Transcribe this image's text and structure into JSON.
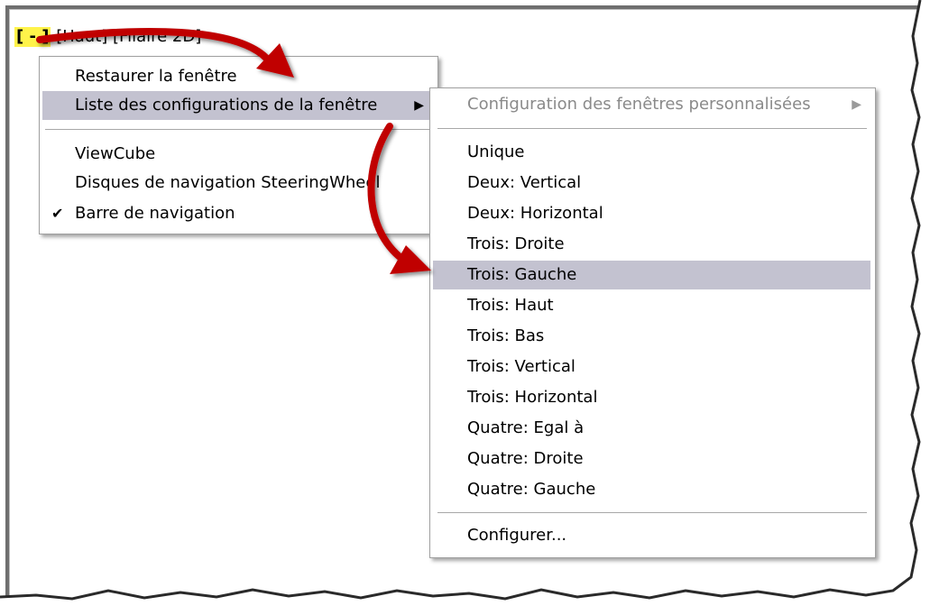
{
  "viewport": {
    "label_minus": "[ - ]",
    "label_view": "[Haut]",
    "label_style": "[Filaire 2D]"
  },
  "main_menu": {
    "items": [
      {
        "label": "Restaurer la fenêtre"
      },
      {
        "label": "Liste des configurations de la fenêtre",
        "submenu_arrow": "▶",
        "highlighted": true
      },
      {
        "label": "ViewCube"
      },
      {
        "label": "Disques de navigation SteeringWheel"
      },
      {
        "label": "Barre de navigation",
        "checked": true,
        "check_mark": "✔"
      }
    ]
  },
  "sub_menu": {
    "header": {
      "label": "Configuration des fenêtres personnalisées",
      "submenu_arrow": "▶",
      "disabled": true
    },
    "items": [
      {
        "label": "Unique"
      },
      {
        "label": "Deux: Vertical"
      },
      {
        "label": "Deux: Horizontal"
      },
      {
        "label": "Trois: Droite"
      },
      {
        "label": "Trois: Gauche",
        "highlighted": true
      },
      {
        "label": "Trois: Haut"
      },
      {
        "label": "Trois: Bas"
      },
      {
        "label": "Trois: Vertical"
      },
      {
        "label": "Trois: Horizontal"
      },
      {
        "label": "Quatre: Egal à"
      },
      {
        "label": "Quatre: Droite"
      },
      {
        "label": "Quatre: Gauche"
      }
    ],
    "footer": {
      "label": "Configurer..."
    }
  },
  "colors": {
    "highlight": "#c3c2d0",
    "annotation_arrow": "#c00000",
    "label_highlight": "#fff34a"
  },
  "icons": [
    "check-icon",
    "submenu-arrow-icon",
    "annotation-arrow-icon"
  ]
}
